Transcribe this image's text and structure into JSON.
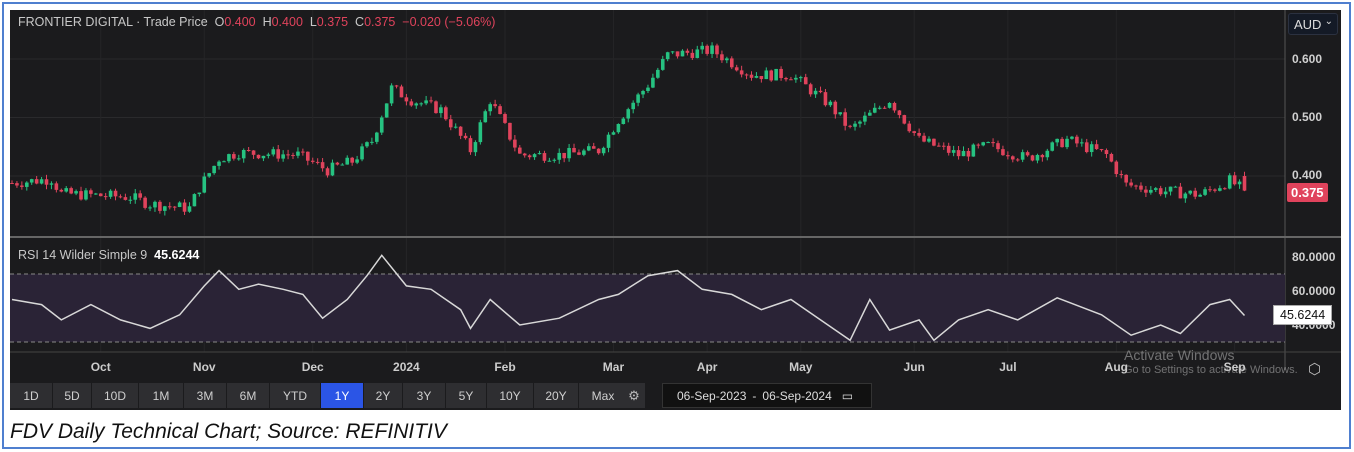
{
  "legend": {
    "name": "FRONTIER DIGITAL",
    "sep": "·",
    "type": "Trade Price",
    "o_label": "O",
    "o": "0.400",
    "h_label": "H",
    "h": "0.400",
    "l_label": "L",
    "l": "0.375",
    "c_label": "C",
    "c": "0.375",
    "change": "−0.020 (−5.06%)"
  },
  "currency": "AUD",
  "rsi_legend": {
    "label": "RSI 14 Wilder Simple 9",
    "value": "45.6244"
  },
  "watermark": {
    "line1": "Activate Windows",
    "line2": "Go to Settings to activate Windows."
  },
  "toolbar": {
    "ranges": [
      "1D",
      "5D",
      "10D",
      "1M",
      "3M",
      "6M",
      "YTD",
      "1Y",
      "2Y",
      "3Y",
      "5Y",
      "10Y",
      "20Y",
      "Max"
    ],
    "active": "1Y",
    "date_from": "06-Sep-2023",
    "date_sep": "-",
    "date_to": "06-Sep-2024"
  },
  "caption": "FDV Daily Technical Chart; Source: REFINITIV",
  "colors": {
    "up": "#26c281",
    "down": "#e0435c",
    "rsi": "#d8d8d8"
  },
  "chart_data": [
    {
      "type": "candlestick",
      "title": "FRONTIER DIGITAL · Trade Price",
      "yticks": [
        "0.600",
        "0.500",
        "0.400"
      ],
      "ylim": [
        0.32,
        0.66
      ],
      "last_price": "0.375",
      "x_unit": "trading day index",
      "xlim": [
        0,
        252
      ],
      "month_labels": [
        {
          "t": "Oct",
          "d": 18
        },
        {
          "t": "Nov",
          "d": 39
        },
        {
          "t": "Dec",
          "d": 61
        },
        {
          "t": "2024",
          "d": 80
        },
        {
          "t": "Feb",
          "d": 100
        },
        {
          "t": "Mar",
          "d": 122
        },
        {
          "t": "Apr",
          "d": 141
        },
        {
          "t": "May",
          "d": 160
        },
        {
          "t": "Jun",
          "d": 183
        },
        {
          "t": "Jul",
          "d": 202
        },
        {
          "t": "Aug",
          "d": 224
        },
        {
          "t": "Sep",
          "d": 248
        }
      ],
      "close_keypoints": [
        [
          0,
          0.388
        ],
        [
          8,
          0.395
        ],
        [
          10,
          0.37
        ],
        [
          24,
          0.364
        ],
        [
          28,
          0.352
        ],
        [
          36,
          0.345
        ],
        [
          38,
          0.38
        ],
        [
          42,
          0.43
        ],
        [
          46,
          0.44
        ],
        [
          58,
          0.436
        ],
        [
          64,
          0.41
        ],
        [
          69,
          0.425
        ],
        [
          73,
          0.46
        ],
        [
          77,
          0.55
        ],
        [
          81,
          0.53
        ],
        [
          87,
          0.513
        ],
        [
          93,
          0.444
        ],
        [
          97,
          0.53
        ],
        [
          103,
          0.436
        ],
        [
          111,
          0.436
        ],
        [
          119,
          0.444
        ],
        [
          123,
          0.496
        ],
        [
          129,
          0.556
        ],
        [
          133,
          0.607
        ],
        [
          142,
          0.615
        ],
        [
          150,
          0.573
        ],
        [
          158,
          0.573
        ],
        [
          166,
          0.521
        ],
        [
          170,
          0.479
        ],
        [
          178,
          0.53
        ],
        [
          184,
          0.462
        ],
        [
          192,
          0.436
        ],
        [
          198,
          0.452
        ],
        [
          206,
          0.43
        ],
        [
          214,
          0.462
        ],
        [
          222,
          0.436
        ],
        [
          226,
          0.385
        ],
        [
          234,
          0.374
        ],
        [
          241,
          0.368
        ],
        [
          247,
          0.392
        ],
        [
          250,
          0.375
        ]
      ]
    },
    {
      "type": "line",
      "title": "RSI 14 Wilder Simple 9",
      "yticks": [
        "80.0000",
        "60.0000",
        "40.0000"
      ],
      "ylim": [
        25,
        90
      ],
      "bands": [
        30,
        70
      ],
      "last_value": "45.6244",
      "points": [
        [
          0,
          55
        ],
        [
          6,
          52
        ],
        [
          10,
          43
        ],
        [
          16,
          52
        ],
        [
          22,
          43
        ],
        [
          28,
          38
        ],
        [
          34,
          46
        ],
        [
          39,
          63
        ],
        [
          42,
          72
        ],
        [
          46,
          61
        ],
        [
          50,
          64
        ],
        [
          55,
          61
        ],
        [
          59,
          58
        ],
        [
          63,
          44
        ],
        [
          68,
          55
        ],
        [
          72,
          69
        ],
        [
          75,
          81
        ],
        [
          80,
          63
        ],
        [
          85,
          61
        ],
        [
          91,
          49
        ],
        [
          93,
          38
        ],
        [
          97,
          55
        ],
        [
          103,
          40
        ],
        [
          111,
          44
        ],
        [
          119,
          55
        ],
        [
          123,
          58
        ],
        [
          129,
          69
        ],
        [
          135,
          72
        ],
        [
          140,
          61
        ],
        [
          146,
          58
        ],
        [
          152,
          49
        ],
        [
          158,
          55
        ],
        [
          164,
          43
        ],
        [
          170,
          31
        ],
        [
          174,
          55
        ],
        [
          178,
          37
        ],
        [
          184,
          43
        ],
        [
          187,
          31
        ],
        [
          192,
          43
        ],
        [
          198,
          49
        ],
        [
          204,
          43
        ],
        [
          212,
          56
        ],
        [
          221,
          46
        ],
        [
          227,
          34
        ],
        [
          233,
          40
        ],
        [
          237,
          35
        ],
        [
          243,
          52
        ],
        [
          247,
          55
        ],
        [
          250,
          45.6
        ]
      ]
    }
  ]
}
